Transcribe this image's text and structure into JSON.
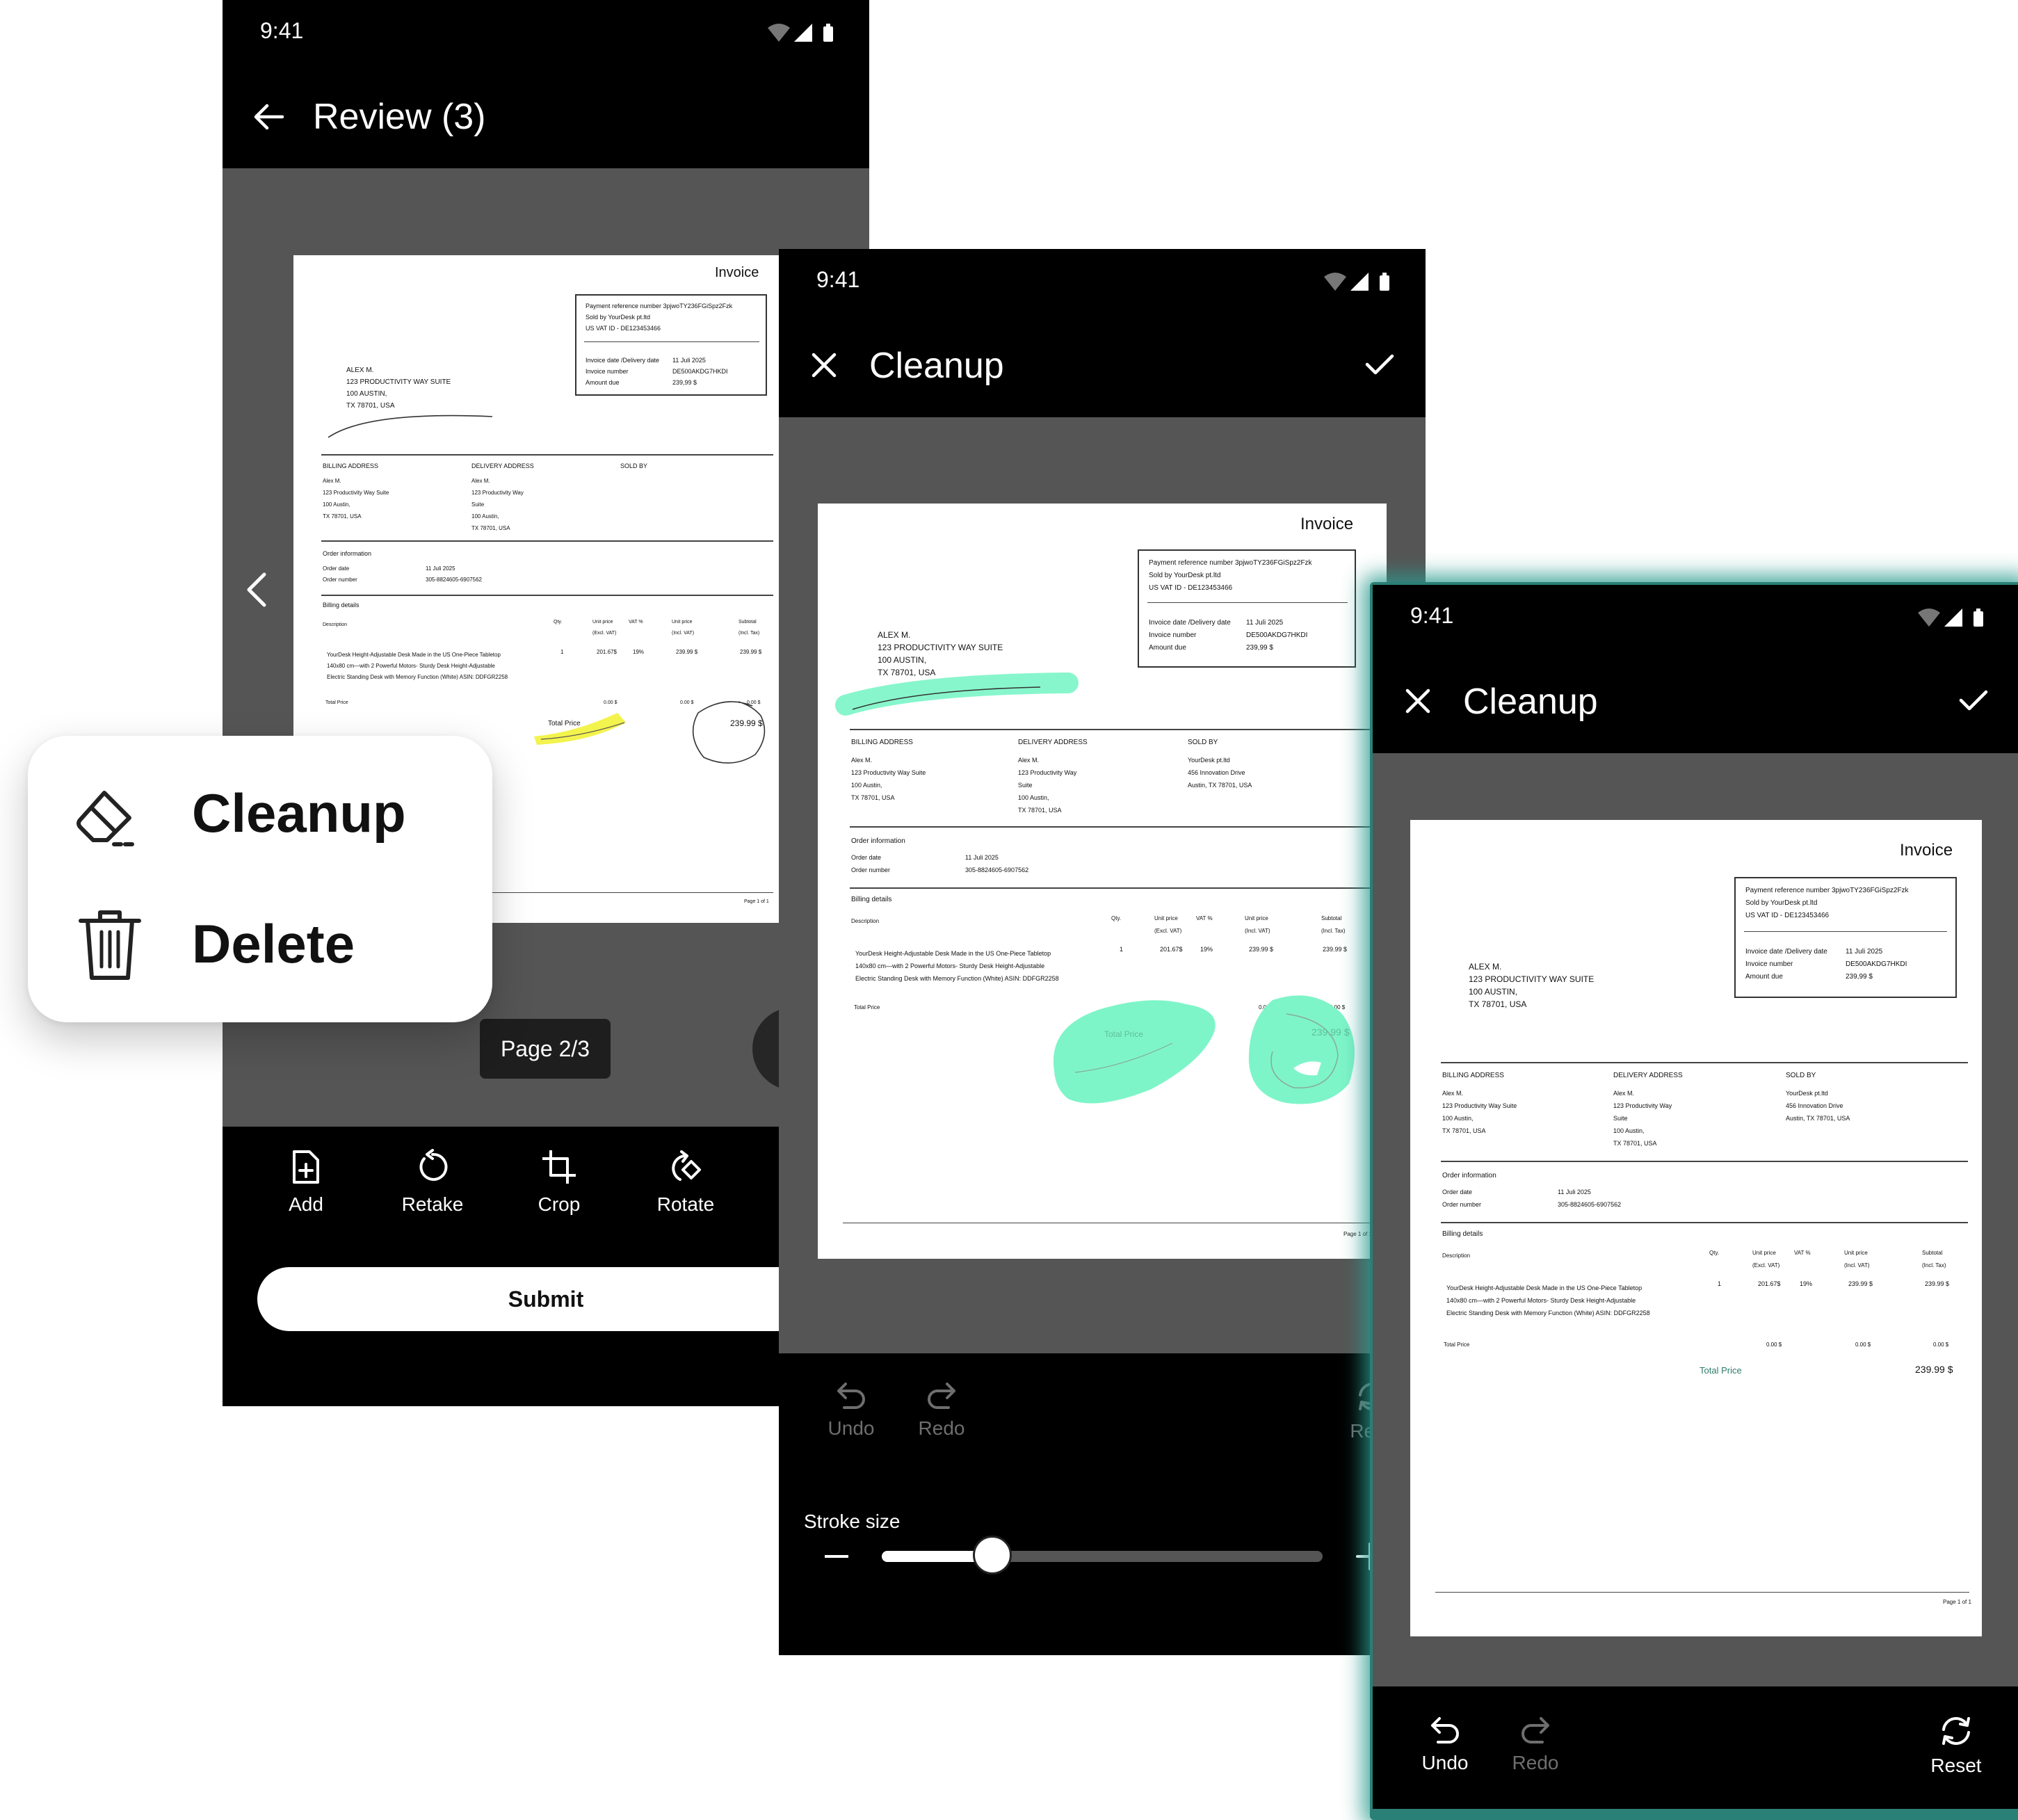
{
  "status": {
    "time": "9:41"
  },
  "screen1": {
    "title": "Review (3)",
    "page_indicator": "Page 2/3",
    "tools": [
      {
        "icon": "add-page-icon",
        "label": "Add"
      },
      {
        "icon": "retake-icon",
        "label": "Retake"
      },
      {
        "icon": "crop-icon",
        "label": "Crop"
      },
      {
        "icon": "rotate-icon",
        "label": "Rotate"
      }
    ],
    "submit_label": "Submit"
  },
  "context_menu": {
    "items": [
      {
        "icon": "eraser-icon",
        "label": "Cleanup"
      },
      {
        "icon": "trash-icon",
        "label": "Delete"
      }
    ]
  },
  "screen2": {
    "title": "Cleanup",
    "undo_label": "Undo",
    "redo_label": "Redo",
    "reset_label": "Rese",
    "stroke_size_label": "Stroke size",
    "stroke_size_value": 0.25,
    "highlight_color": "#7ef5c8"
  },
  "screen3": {
    "title": "Cleanup",
    "undo_label": "Undo",
    "redo_label": "Redo",
    "reset_label": "Reset",
    "glow_color": "#2a9b8f"
  },
  "invoice": {
    "title": "Invoice",
    "payment_ref": "Payment reference number 3pjwoTY236FGiSpz2Fzk",
    "sold_by_line": "Sold by YourDesk pt.ltd",
    "vat_id": "US VAT ID - DE123453466",
    "invoice_date_label": "Invoice date /Delivery date",
    "invoice_date_value": "11 Juli 2025",
    "invoice_number_label": "Invoice number",
    "invoice_number_value": "DE500AKDG7HKDI",
    "amount_due_label": "Amount due",
    "amount_due_value": "239,99 $",
    "customer_name": "ALEX M.",
    "customer_street": "123 PRODUCTIVITY WAY SUITE",
    "customer_city": "100 AUSTIN,",
    "customer_state": "TX 78701, USA",
    "billing_heading": "BILLING ADDRESS",
    "billing_lines": [
      "Alex M.",
      "123 Productivity Way Suite",
      "100 Austin,",
      "TX 78701, USA"
    ],
    "delivery_heading": "DELIVERY ADDRESS",
    "delivery_lines": [
      "Alex M.",
      "123 Productivity Way",
      "Suite",
      "100 Austin,",
      "TX 78701, USA"
    ],
    "soldby_heading": "SOLD BY",
    "soldby_lines": [
      "YourDesk pt.ltd",
      "456 Innovation Drive",
      "Austin, TX 78701, USA"
    ],
    "order_heading": "Order information",
    "order_date_label": "Order date",
    "order_date_value": "11 Juli 2025",
    "order_number_label": "Order number",
    "order_number_value": "305-8824605-6907562",
    "billing_details_heading": "Billing details",
    "col_description": "Description",
    "col_qty": "Qty.",
    "col_unit_excl_1": "Unit price",
    "col_unit_excl_2": "(Excl. VAT)",
    "col_vat": "VAT %",
    "col_unit_incl_1": "Unit price",
    "col_unit_incl_2": "(Incl. VAT)",
    "col_subtotal_1": "Subtotal",
    "col_subtotal_2": "(Incl. Tax)",
    "item_lines": [
      "YourDesk Height-Adjustable Desk Made in the US One-Piece Tabletop",
      "140x80 cm—with 2 Powerful Motors- Sturdy Desk Height-Adjustable",
      "Electric Standing Desk with Memory Function (White) ASIN: DDFGR2258"
    ],
    "item_qty": "1",
    "item_unit_excl": "201.67$",
    "item_vat": "19%",
    "item_unit_incl": "239.99 $",
    "item_subtotal": "239.99 $",
    "total_label": "Total Price",
    "zero1": "0.00 $",
    "zero2": "0.00 $",
    "zero3": "0.00 $",
    "total_price_label": "Total Price",
    "total_price_value": "239.99 $",
    "page_footer": "Page 1 of 1"
  }
}
